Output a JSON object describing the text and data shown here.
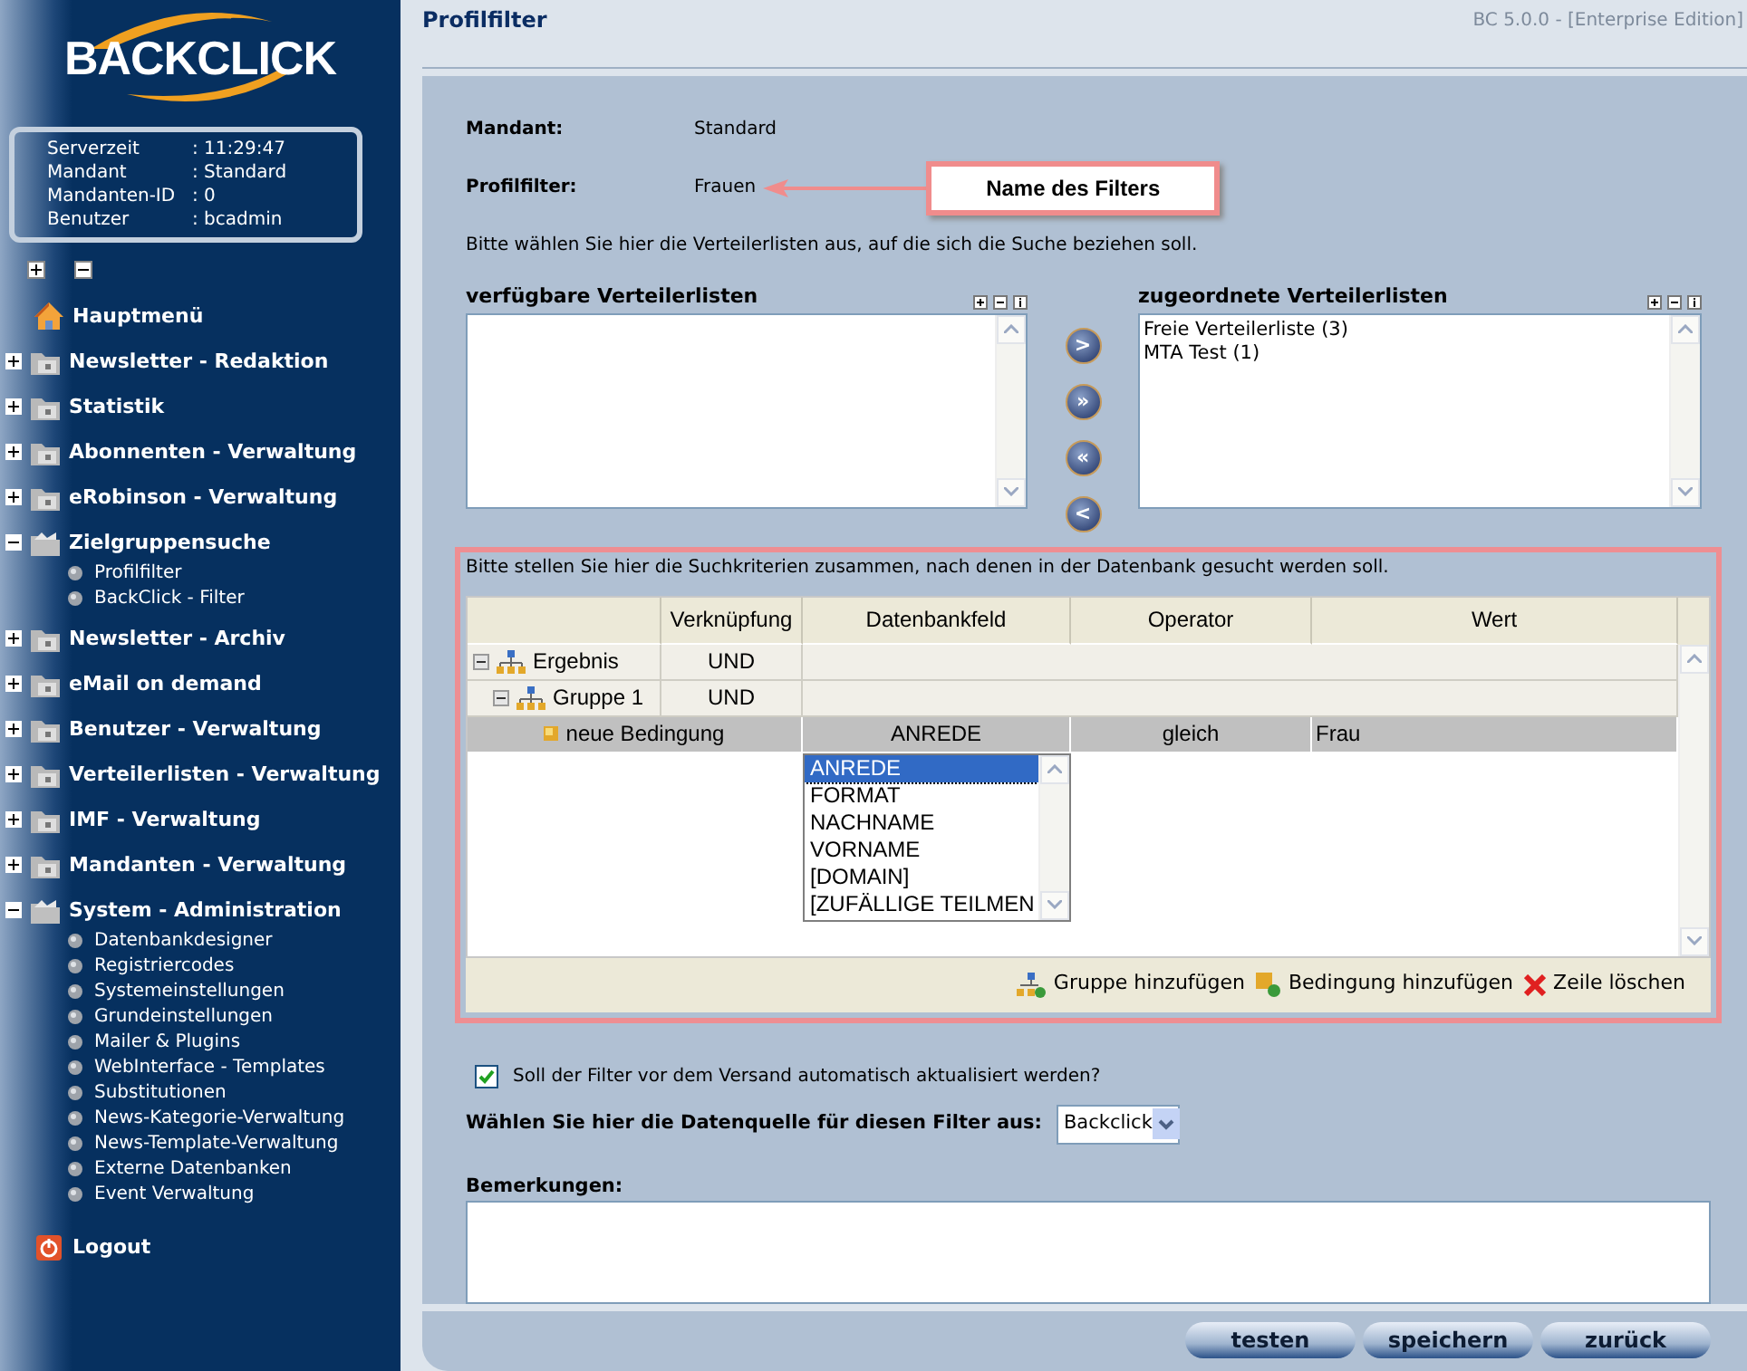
{
  "sidebar": {
    "logo": "BACKCLICK",
    "info": [
      {
        "label": "Serverzeit",
        "value": ": 11:29:47"
      },
      {
        "label": "Mandant",
        "value": ": Standard"
      },
      {
        "label": "Mandanten-ID",
        "value": ": 0"
      },
      {
        "label": "Benutzer",
        "value": ": bcadmin"
      }
    ],
    "menu": [
      {
        "label": "Hauptmenü",
        "kind": "home"
      },
      {
        "label": "Newsletter - Redaktion",
        "kind": "folder",
        "expanded": false
      },
      {
        "label": "Statistik",
        "kind": "folder",
        "expanded": false
      },
      {
        "label": "Abonnenten - Verwaltung",
        "kind": "folder",
        "expanded": false
      },
      {
        "label": "eRobinson - Verwaltung",
        "kind": "folder",
        "expanded": false
      },
      {
        "label": "Zielgruppensuche",
        "kind": "folder",
        "expanded": true,
        "children": [
          {
            "label": "Profilfilter"
          },
          {
            "label": "BackClick - Filter"
          }
        ]
      },
      {
        "label": "Newsletter - Archiv",
        "kind": "folder",
        "expanded": false
      },
      {
        "label": "eMail on demand",
        "kind": "folder",
        "expanded": false
      },
      {
        "label": "Benutzer - Verwaltung",
        "kind": "folder",
        "expanded": false
      },
      {
        "label": "Verteilerlisten - Verwaltung",
        "kind": "folder",
        "expanded": false
      },
      {
        "label": "IMF - Verwaltung",
        "kind": "folder",
        "expanded": false
      },
      {
        "label": "Mandanten - Verwaltung",
        "kind": "folder",
        "expanded": false
      },
      {
        "label": "System - Administration",
        "kind": "folder",
        "expanded": true,
        "children": [
          {
            "label": "Datenbankdesigner"
          },
          {
            "label": "Registriercodes"
          },
          {
            "label": "Systemeinstellungen"
          },
          {
            "label": "Grundeinstellungen"
          },
          {
            "label": "Mailer & Plugins"
          },
          {
            "label": "WebInterface - Templates"
          },
          {
            "label": "Substitutionen"
          },
          {
            "label": "News-Kategorie-Verwaltung"
          },
          {
            "label": "News-Template-Verwaltung"
          },
          {
            "label": "Externe Datenbanken"
          },
          {
            "label": "Event Verwaltung"
          }
        ]
      },
      {
        "label": "Logout",
        "kind": "logout"
      }
    ]
  },
  "header": {
    "title": "Profilfilter",
    "version": "BC 5.0.0 - [Enterprise Edition]"
  },
  "fields": [
    {
      "label": "Mandant:",
      "value": "Standard"
    },
    {
      "label": "Profilfilter:",
      "value": "Frauen"
    }
  ],
  "callout": "Name des Filters",
  "lists_intro": "Bitte wählen Sie hier die Verteilerlisten aus, auf die sich die Suche beziehen soll.",
  "available": {
    "title": "verfügbare Verteilerlisten"
  },
  "assigned": {
    "title": "zugeordnete Verteilerlisten",
    "items": [
      "Freie Verteilerliste (3)",
      "MTA Test (1)"
    ]
  },
  "move_buttons": [
    ">",
    "»",
    "«",
    "<"
  ],
  "criteria": {
    "intro": "Bitte stellen Sie hier die Suchkriterien zusammen, nach denen in der Datenbank gesucht werden soll.",
    "columns": [
      "Verknüpfung",
      "Datenbankfeld",
      "Operator",
      "Wert"
    ],
    "rows": [
      {
        "kind": "group",
        "label": "Ergebnis",
        "link": "UND",
        "expanded": true,
        "children": [
          {
            "kind": "group",
            "label": "Gruppe 1",
            "link": "UND",
            "expanded": true,
            "children": [
              {
                "kind": "condition",
                "label": "neue Bedingung",
                "field": "ANREDE",
                "operator": "gleich",
                "value": "Frau",
                "selected": true
              }
            ]
          }
        ]
      }
    ],
    "field_options": [
      {
        "label": "ANREDE",
        "selected": true
      },
      {
        "label": "FORMAT",
        "selected": false
      },
      {
        "label": "NACHNAME",
        "selected": false
      },
      {
        "label": "VORNAME",
        "selected": false
      },
      {
        "label": "[DOMAIN]",
        "selected": false
      },
      {
        "label": "[ZUFÄLLIGE TEILMEN",
        "selected": false
      }
    ],
    "actions": [
      {
        "label": "Gruppe hinzufügen",
        "kind": "group"
      },
      {
        "label": "Bedingung hinzufügen",
        "kind": "condition"
      },
      {
        "label": "Zeile löschen",
        "kind": "delete"
      }
    ]
  },
  "auto_update": {
    "label": "Soll der Filter vor dem Versand automatisch aktualisiert werden?",
    "checked": true
  },
  "source": {
    "label": "Wählen Sie hier die Datenquelle für diesen Filter aus:",
    "value": "Backclick"
  },
  "remarks": {
    "label": "Bemerkungen:"
  },
  "buttons": [
    "testen",
    "speichern",
    "zurück"
  ]
}
